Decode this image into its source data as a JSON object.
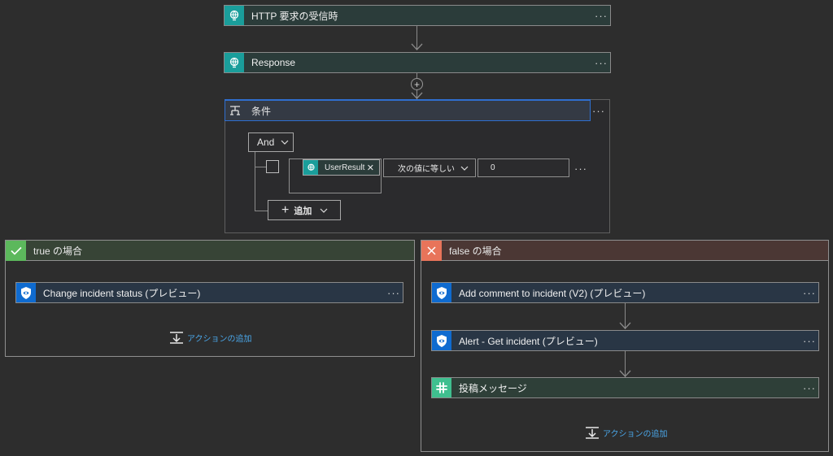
{
  "flow": {
    "trigger": {
      "label": "HTTP 要求の受信時",
      "icon": "http-trigger-icon"
    },
    "response": {
      "label": "Response",
      "icon": "http-icon"
    }
  },
  "condition": {
    "title": "条件",
    "operator": "And",
    "token_label": "UserResult",
    "comparison": "次の値に等しい",
    "value": "0",
    "add_label": "追加"
  },
  "true_branch": {
    "title": "true の場合",
    "actions": [
      {
        "label": "Change incident status (プレビュー)"
      }
    ],
    "add_action": "アクションの追加"
  },
  "false_branch": {
    "title": "false の場合",
    "actions": [
      {
        "label": "Add comment to incident (V2) (プレビュー)"
      },
      {
        "label": "Alert - Get incident (プレビュー)"
      },
      {
        "label": "投稿メッセージ"
      }
    ],
    "add_action": "アクションの追加"
  },
  "colors": {
    "background": "#2d2d2d",
    "teal": "#1a9e9b",
    "sentinel_blue": "#0f6bd0",
    "true_green": "#5cb85c",
    "false_red": "#e8745a",
    "link_blue": "#4aa6e8"
  }
}
